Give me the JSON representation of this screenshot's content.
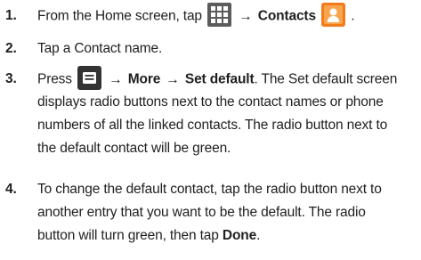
{
  "steps": [
    {
      "number": "1.",
      "lines": [
        {
          "parts": [
            "From the Home screen, tap",
            "→",
            "Contacts",
            "."
          ]
        }
      ],
      "icons": [
        "apps-grid-icon",
        "contacts-icon"
      ]
    },
    {
      "number": "2.",
      "lines": [
        {
          "text": "Tap a Contact name."
        }
      ]
    },
    {
      "number": "3.",
      "lines": [
        {
          "parts": [
            "Press",
            "→",
            "More",
            "→",
            "Set default",
            ". The Set default screen"
          ]
        },
        {
          "text": "displays radio buttons next to the contact names or phone"
        },
        {
          "text": "numbers of all the linked contacts. The radio button next to"
        },
        {
          "text": "the default contact will be green."
        }
      ],
      "icons": [
        "menu-key-icon"
      ]
    },
    {
      "number": "4.",
      "lines": [
        {
          "text": "To change the default contact, tap the radio button next to"
        },
        {
          "text": "another entry that you want to be the default. The radio"
        },
        {
          "parts": [
            "button will turn green, then tap",
            "Done",
            "."
          ]
        }
      ]
    }
  ],
  "colors": {
    "text": "#1f1f1f",
    "apps_icon_fill": "#5b5b5b",
    "contacts_icon_fill": "#f27b1b",
    "menu_icon_fill": "#333333"
  }
}
